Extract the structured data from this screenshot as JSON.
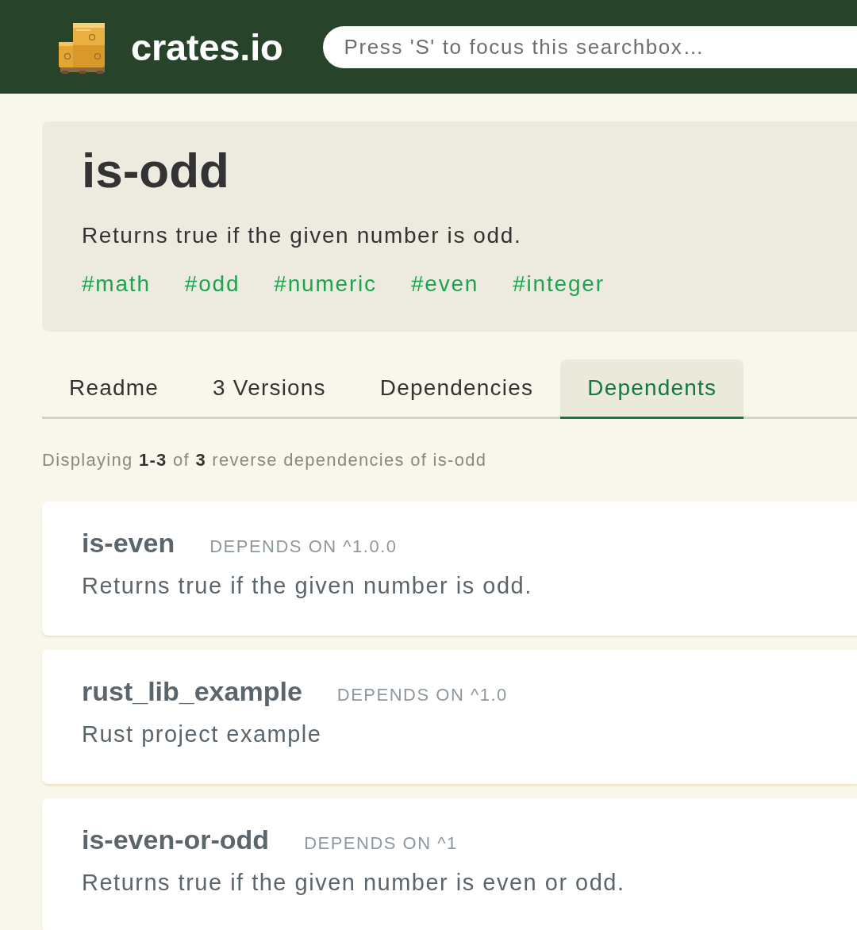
{
  "header": {
    "logo_text": "crates.io",
    "search": {
      "placeholder": "Press 'S' to focus this searchbox…"
    }
  },
  "crate": {
    "name": "is-odd",
    "description": "Returns true if the given number is odd.",
    "keywords": [
      "#math",
      "#odd",
      "#numeric",
      "#even",
      "#integer"
    ]
  },
  "tabs": [
    {
      "label": "Readme",
      "selected": false
    },
    {
      "label": "3 Versions",
      "selected": false
    },
    {
      "label": "Dependencies",
      "selected": false
    },
    {
      "label": "Dependents",
      "selected": true
    }
  ],
  "summary": "Displaying **1-3** of **3** reverse dependencies of is-odd",
  "dependents": [
    {
      "name": "is-even",
      "requirement": "DEPENDS ON ^1.0.0",
      "description": "Returns true if the given number is odd."
    },
    {
      "name": "rust_lib_example",
      "requirement": "DEPENDS ON ^1.0",
      "description": "Rust project example"
    },
    {
      "name": "is-even-or-odd",
      "requirement": "DEPENDS ON ^1",
      "description": "Returns true if the given number is even or odd."
    }
  ]
}
